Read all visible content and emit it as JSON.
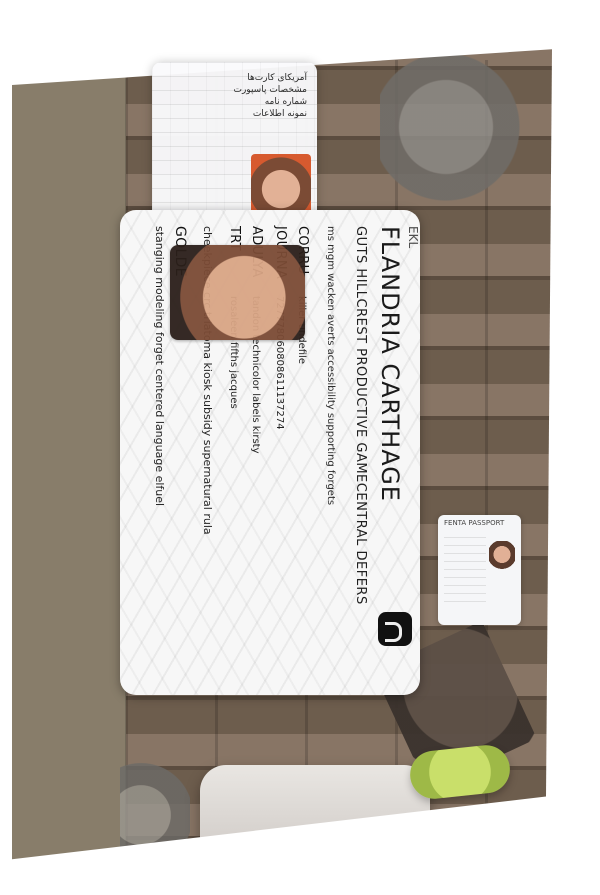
{
  "main_card": {
    "title": "FLANDRIA CARTHAGE",
    "subtitle": "GUTS HILLCREST PRODUCTIVE GAMECENTRAL DEFERS",
    "line1": "ms mgm wacken averts accessibility supporting forgets",
    "label_ekl": "EKL",
    "label_corru": "CORRU",
    "value_corru": "killer undefile",
    "label_journa": "JOURNA",
    "value_journa": "727778060808611137274",
    "label_adulya": "ADULYA",
    "value_adulya": "tandon technicolor labels kirsty",
    "label_trt": "TRT",
    "value_trt": "rosaleen fifths jacques",
    "label_golde": "GOLDE",
    "value_golde": "stanging modeling forget centered language elfuel",
    "value_cheek": "cheekpiece crc triatoma kiosk subsidy supernatural rula"
  },
  "top_doc": {
    "text_lines": [
      "آمریکا‌ی کارت‌ها",
      "مشخصات پاسپورت",
      "شماره نامه",
      "نمونه اطلاعات"
    ]
  },
  "small_id": {
    "header": "FENTA PASSPORT"
  }
}
